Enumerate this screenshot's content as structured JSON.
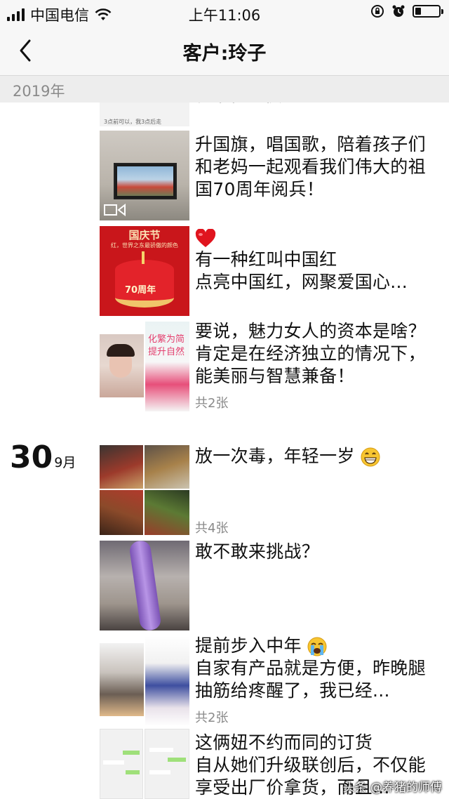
{
  "status": {
    "carrier": "中国电信",
    "time": "上午11:06"
  },
  "nav": {
    "title": "客户:玲子"
  },
  "year_label": "2019年",
  "posts": [
    {
      "text": "升国旗，唱国歌，陪着孩子们和老妈一起观看我们伟大的祖国70周年阅兵！"
    },
    {
      "text_line1": "有一种红叫中国红",
      "text_line2": "点亮中国红，网聚爱国心...",
      "thumb_title": "国庆节",
      "thumb_sub": "红，世界之东最骄傲的颜色",
      "thumb_cake": "70周年"
    },
    {
      "text": "要说，魅力女人的资本是啥？肯定是在经济独立的情况下，能美丽与智慧兼备！",
      "count": "共2张",
      "thumb_text1": "化繁为简",
      "thumb_text2": "提升自然"
    },
    {
      "text": "放一次毒，年轻一岁",
      "count": "共4张"
    },
    {
      "text": "敢不敢来挑战？"
    },
    {
      "text_line1": "提前步入中年",
      "text_line2": "自家有产品就是方便，昨晚腿抽筋给疼醒了，我已经...",
      "count": "共2张"
    },
    {
      "text_line1": "这俩妞不约而同的订货",
      "text_line2": "自从她们升级联创后，不仅能享受出厂价拿货，而且..."
    }
  ],
  "date": {
    "day": "30",
    "month": "9月"
  },
  "partial_top_caption": "3点前可以，我3点后走",
  "watermark": "头条 @养猪的师傅",
  "colors": {
    "bar_bg": "#f7f7f7",
    "year_bg": "#ededed",
    "muted": "#8a8a8a"
  },
  "icons": [
    "back-arrow-icon",
    "wifi-icon",
    "signal-icon",
    "battery-icon",
    "alarm-icon",
    "rotation-lock-icon",
    "video-icon",
    "heart-emoji",
    "grin-emoji",
    "tears-emoji"
  ]
}
